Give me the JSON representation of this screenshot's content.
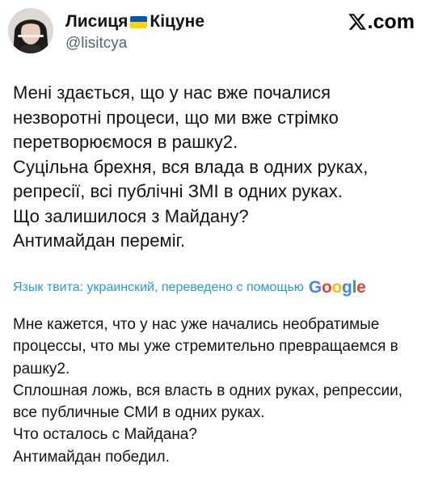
{
  "author": {
    "name_part1": "Лисиця",
    "name_part2": "Кіцуне",
    "flag_icon": "ukraine-flag",
    "handle": "@lisitcya"
  },
  "brand": {
    "label": ".com",
    "icon": "x-logo-icon"
  },
  "tweet": {
    "lines": [
      "Мені здається, що у нас вже почалися",
      "незворотні процеси, що ми вже стрімко",
      "перетворюємося в рашку2.",
      "Суцільна брехня, вся влада в одних руках,",
      "репресії, всі публічні ЗМІ в одних руках.",
      "Що залишилося з Майдану?",
      "Антимайдан переміг."
    ]
  },
  "translation_note": {
    "text": "Язык твита: украинский, переведено с помощью",
    "provider": "Google"
  },
  "translation": {
    "lines": [
      "Мне кажется, что у нас уже начались необратимые",
      "процессы, что мы уже стремительно превращаемся в",
      "рашку2.",
      "Сплошная ложь, вся власть в одних руках, репрессии,",
      "все публичные СМИ в одних руках.",
      "Что осталось с Майдана?",
      "Антимайдан победил."
    ]
  },
  "colors": {
    "text": "#0f1419",
    "secondary": "#536471",
    "link": "#1d9bf0",
    "flag_blue": "#0057b7",
    "flag_yellow": "#ffd700"
  }
}
